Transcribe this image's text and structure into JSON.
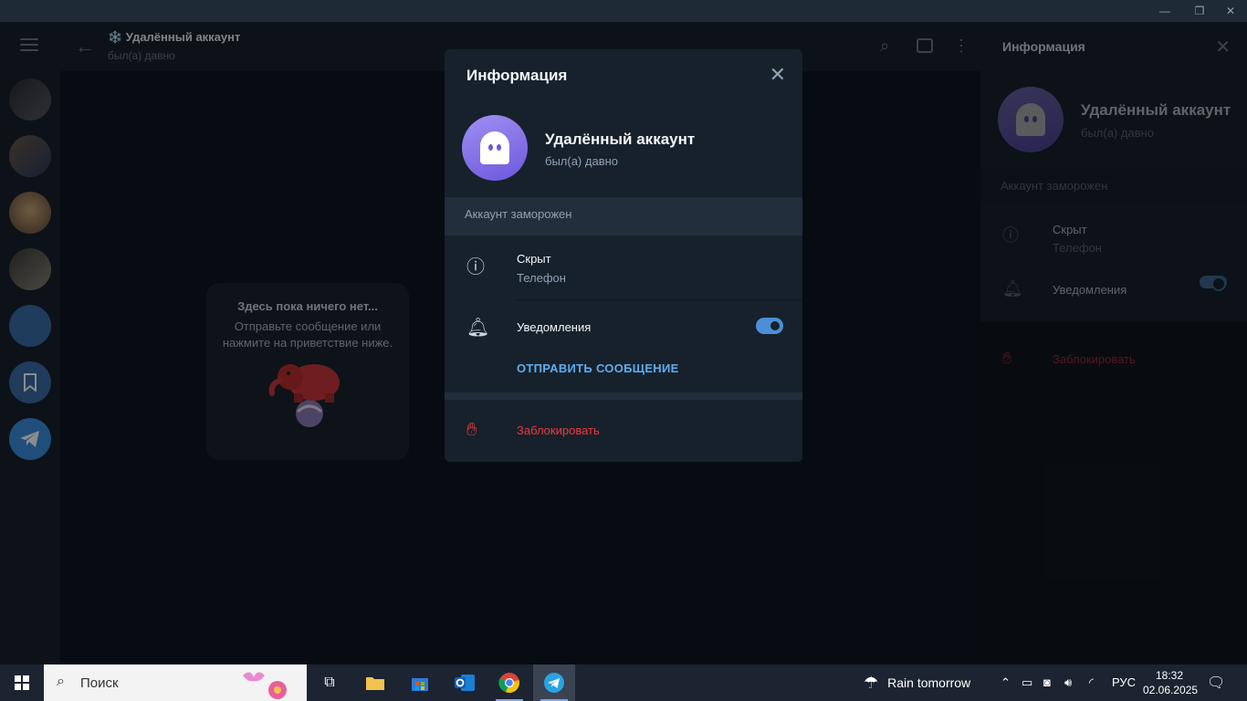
{
  "window": {
    "minimize": "—",
    "restore": "❐",
    "close": "✕"
  },
  "chat": {
    "title": "❄️ Удалённый аккаунт",
    "subtitle": "был(а) давно",
    "empty_title": "Здесь пока ничего нет...",
    "empty_text": "Отправьте сообщение или нажмите на приветствие ниже."
  },
  "info_panel": {
    "title": "Информация",
    "name": "Удалённый аккаунт",
    "status": "был(а) давно",
    "frozen": "Аккаунт заморожен",
    "phone_value": "Скрыт",
    "phone_label": "Телефон",
    "notifications": "Уведомления",
    "notifications_on": true,
    "block": "Заблокировать"
  },
  "modal": {
    "title": "Информация",
    "name": "Удалённый аккаунт",
    "status": "был(а) давно",
    "frozen": "Аккаунт заморожен",
    "phone_value": "Скрыт",
    "phone_label": "Телефон",
    "notifications": "Уведомления",
    "notifications_on": true,
    "send_message": "ОТПРАВИТЬ СООБЩЕНИЕ",
    "block": "Заблокировать"
  },
  "taskbar": {
    "search_placeholder": "Поиск",
    "weather": "Rain tomorrow",
    "language": "РУС",
    "time": "18:32",
    "date": "02.06.2025"
  },
  "colors": {
    "accent": "#4d8fd6",
    "danger": "#ec3942",
    "avatar": "#7b68e6"
  }
}
